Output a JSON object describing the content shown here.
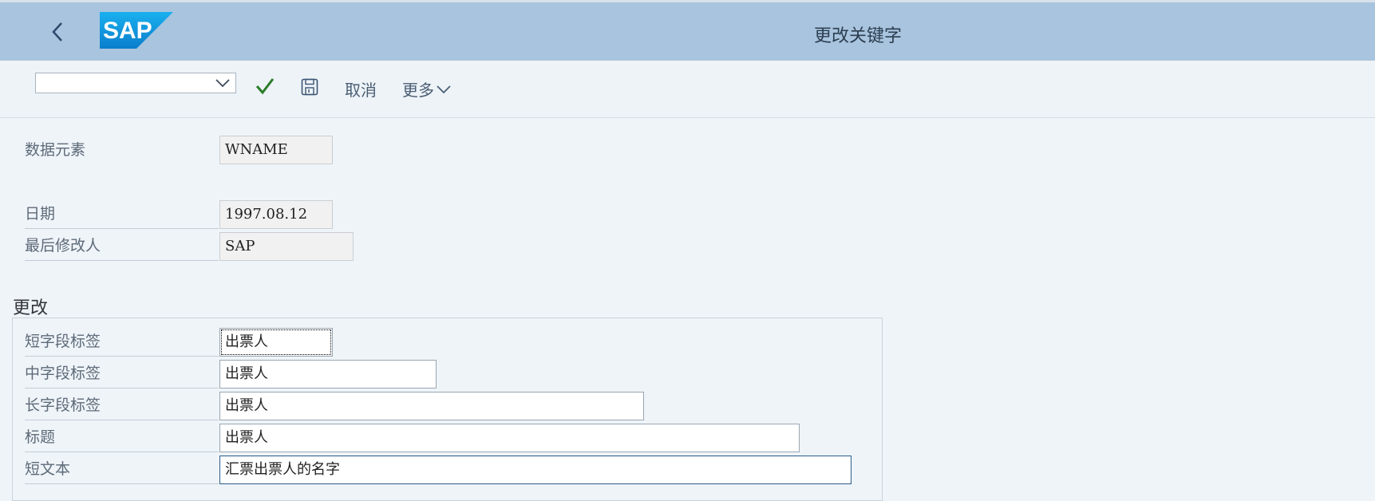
{
  "header": {
    "title": "更改关键字",
    "logo_text": "SAP"
  },
  "toolbar": {
    "command_value": "",
    "cancel_label": "取消",
    "more_label": "更多"
  },
  "fields": {
    "data_element": {
      "label": "数据元素",
      "value": "WNAME"
    },
    "date": {
      "label": "日期",
      "value": "1997.08.12"
    },
    "last_changed_by": {
      "label": "最后修改人",
      "value": "SAP"
    }
  },
  "change_group": {
    "title": "更改",
    "rows": [
      {
        "label": "短字段标签",
        "value": "出票人"
      },
      {
        "label": "中字段标签",
        "value": "出票人"
      },
      {
        "label": "长字段标签",
        "value": "出票人"
      },
      {
        "label": "标题",
        "value": "出票人"
      },
      {
        "label": "短文本",
        "value": "汇票出票人的名字"
      }
    ]
  },
  "icons": [
    "back-arrow-icon",
    "sap-logo",
    "chevron-down-icon",
    "checkmark-icon",
    "save-icon"
  ],
  "colors": {
    "header_bg": "#a9c4de",
    "page_bg": "#eff4f9",
    "check_green": "#2b7d2b"
  }
}
